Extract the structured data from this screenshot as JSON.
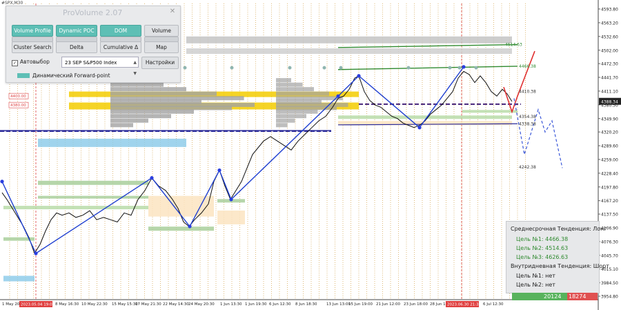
{
  "window": {
    "symbol": "#SPX,M30"
  },
  "chart": {
    "price_labels": [
      "4593.80",
      "4563.20",
      "4532.60",
      "4502.00",
      "4472.30",
      "4441.70",
      "4411.10",
      "4380.50",
      "4349.90",
      "4320.20",
      "4289.60",
      "4259.00",
      "4228.40",
      "4197.80",
      "4167.20",
      "4137.50",
      "4106.90",
      "4076.30",
      "4045.70",
      "4015.10",
      "3984.50",
      "3954.80"
    ],
    "current_price": "4388.34",
    "date_labels": [
      "1 May 2023",
      "8 May 16:30",
      "10 May 22:30",
      "15 May 15:30",
      "17 May 21:30",
      "22 May 14:30",
      "24 May 20:30",
      "1 Jun 13:30",
      "1 Jun 19:30",
      "6 Jun 12:30",
      "8 Jun 18:30",
      "13 Jun 13:00",
      "15 Jun 19:00",
      "21 Jun 12:00",
      "23 Jun 18:00",
      "28 Jun 1",
      "6 Jul 12:30"
    ],
    "date_highlights": [
      "2023.05.04 19:00",
      "2023.06.30 21:30"
    ],
    "level_labels": [
      {
        "text": "4514.63",
        "color": "#2f8a2f"
      },
      {
        "text": "4466.38",
        "color": "#2f8a2f"
      },
      {
        "text": "4410.38",
        "color": "#333333"
      },
      {
        "text": "4354.38",
        "color": "#333333"
      },
      {
        "text": "4338.38",
        "color": "#333333"
      },
      {
        "text": "4242.38",
        "color": "#333333"
      }
    ],
    "left_level_labels": [
      "4400.00",
      "4380.00"
    ]
  },
  "panel": {
    "title": "ProVolume 2.07",
    "buttons": [
      {
        "label": "Volume Profile",
        "active": true
      },
      {
        "label": "Dynamic POC",
        "active": true
      },
      {
        "label": "DOM",
        "active": true
      },
      {
        "label": "Volume",
        "active": false
      },
      {
        "label": "Cluster Search",
        "active": false
      },
      {
        "label": "Delta",
        "active": false
      },
      {
        "label": "Cumulative Δ",
        "active": false
      },
      {
        "label": "Map",
        "active": false
      }
    ],
    "auto_label": "Автовыбор",
    "auto_checked": "✓",
    "instrument": "23 SEP S&P500 Index",
    "settings_label": "Настройки",
    "forward_label": "Динамический Forward-point"
  },
  "info": {
    "mid_title": "Среднесрочная Тенденция: Лонг",
    "mid_targets": [
      "Цель №1: 4466.38",
      "Цель №2: 4514.63",
      "Цель №3: 4626.63"
    ],
    "intra_title": "Внутридневная Тенденция: Шорт",
    "intra_targets": [
      "Цель №1: нет",
      "Цель №2: нет"
    ]
  },
  "footer": {
    "left_value": "20124",
    "right_value": "18274"
  },
  "colors": {
    "profile": "#a3a3a3",
    "poc": "#f3cd00",
    "trend_line": "#1f3fd0",
    "forecast_up": "#e03030",
    "forecast_down": "#3a57d8"
  }
}
